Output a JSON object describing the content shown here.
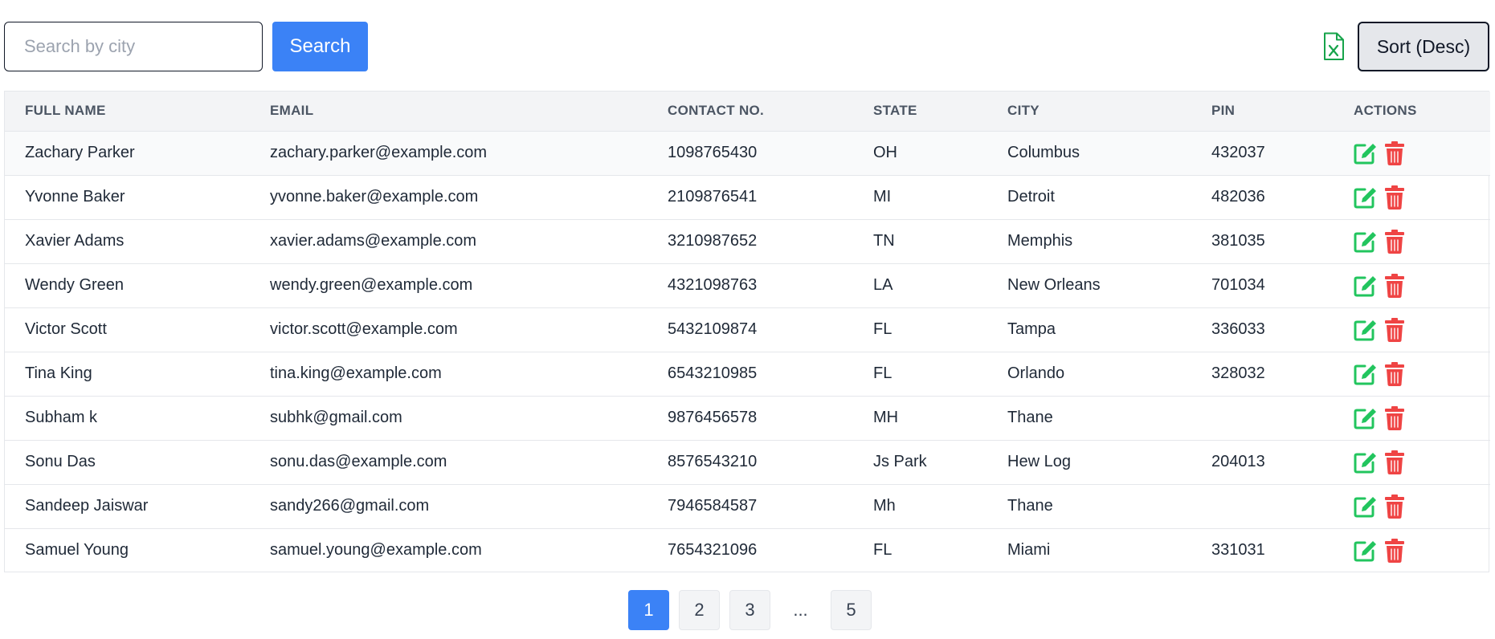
{
  "toolbar": {
    "search_placeholder": "Search by city",
    "search_value": "",
    "search_label": "Search",
    "export_icon": "excel-file-icon",
    "sort_label": "Sort (Desc)"
  },
  "table": {
    "headers": [
      "FULL NAME",
      "EMAIL",
      "CONTACT NO.",
      "STATE",
      "CITY",
      "PIN",
      "ACTIONS"
    ],
    "rows": [
      {
        "name": "Zachary Parker",
        "email": "zachary.parker@example.com",
        "contact": "1098765430",
        "state": "OH",
        "city": "Columbus",
        "pin": "432037"
      },
      {
        "name": "Yvonne Baker",
        "email": "yvonne.baker@example.com",
        "contact": "2109876541",
        "state": "MI",
        "city": "Detroit",
        "pin": "482036"
      },
      {
        "name": "Xavier Adams",
        "email": "xavier.adams@example.com",
        "contact": "3210987652",
        "state": "TN",
        "city": "Memphis",
        "pin": "381035"
      },
      {
        "name": "Wendy Green",
        "email": "wendy.green@example.com",
        "contact": "4321098763",
        "state": "LA",
        "city": "New Orleans",
        "pin": "701034"
      },
      {
        "name": "Victor Scott",
        "email": "victor.scott@example.com",
        "contact": "5432109874",
        "state": "FL",
        "city": "Tampa",
        "pin": "336033"
      },
      {
        "name": "Tina King",
        "email": "tina.king@example.com",
        "contact": "6543210985",
        "state": "FL",
        "city": "Orlando",
        "pin": "328032"
      },
      {
        "name": "Subham k",
        "email": "subhk@gmail.com",
        "contact": "9876456578",
        "state": "MH",
        "city": "Thane",
        "pin": ""
      },
      {
        "name": "Sonu Das",
        "email": "sonu.das@example.com",
        "contact": "8576543210",
        "state": "Js Park",
        "city": "Hew Log",
        "pin": "204013"
      },
      {
        "name": "Sandeep Jaiswar",
        "email": "sandy266@gmail.com",
        "contact": "7946584587",
        "state": "Mh",
        "city": "Thane",
        "pin": ""
      },
      {
        "name": "Samuel Young",
        "email": "samuel.young@example.com",
        "contact": "7654321096",
        "state": "FL",
        "city": "Miami",
        "pin": "331031"
      }
    ],
    "row_icons": {
      "edit": "edit-icon",
      "delete": "trash-icon"
    }
  },
  "pagination": {
    "items": [
      "1",
      "2",
      "3",
      "...",
      "5"
    ],
    "current": "1"
  },
  "colors": {
    "primary": "#3b82f6",
    "edit": "#22c55e",
    "delete": "#ef4444",
    "excel": "#16a34a"
  }
}
